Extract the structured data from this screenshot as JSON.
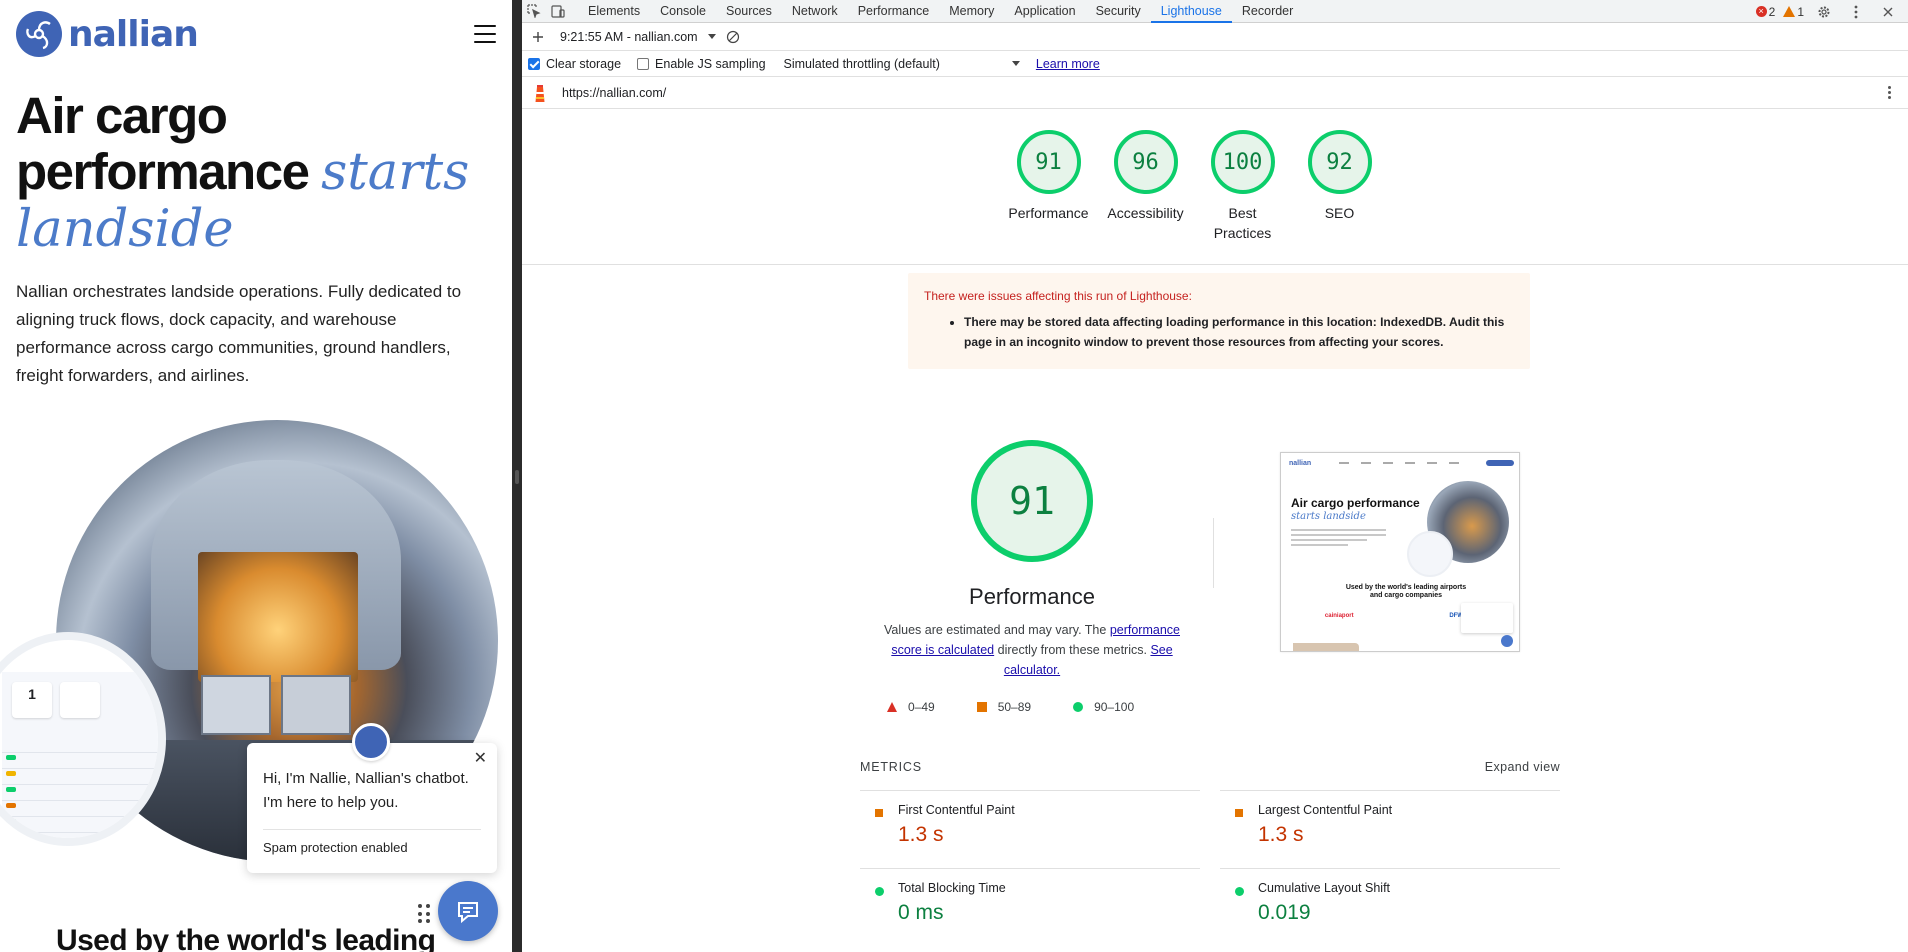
{
  "site": {
    "brand": "nallian",
    "hero": {
      "title_line1": "Air cargo",
      "title_line2": "performance",
      "title_script1": "starts",
      "title_script2": "landside",
      "description": "Nallian orchestrates landside operations. Fully dedicated to aligning truck flows, dock capacity, and warehouse performance across cargo communities, ground handlers, freight forwarders, and airlines."
    },
    "dashboard_card": {
      "count": "1"
    },
    "chat": {
      "message": "Hi, I'm Nallie, Nallian's chatbot. I'm here to help you.",
      "footer": "Spam protection enabled",
      "close_glyph": "✕"
    },
    "used_by_heading": "Used by the world's leading"
  },
  "devtools": {
    "tabs": [
      {
        "label": "Elements"
      },
      {
        "label": "Console"
      },
      {
        "label": "Sources"
      },
      {
        "label": "Network"
      },
      {
        "label": "Performance"
      },
      {
        "label": "Memory"
      },
      {
        "label": "Application"
      },
      {
        "label": "Security"
      },
      {
        "label": "Lighthouse"
      },
      {
        "label": "Recorder"
      }
    ],
    "active_tab": "Lighthouse",
    "error_count": "2",
    "warning_count": "1",
    "report_selector": "9:21:55 AM - nallian.com",
    "options": {
      "clear_storage": "Clear storage",
      "clear_storage_checked": true,
      "js_sampling": "Enable JS sampling",
      "js_sampling_checked": false,
      "throttling": "Simulated throttling (default)",
      "learn_more": "Learn more"
    },
    "url": "https://nallian.com/",
    "scores": [
      {
        "value": "91",
        "label": "Performance"
      },
      {
        "value": "96",
        "label": "Accessibility"
      },
      {
        "value": "100",
        "label": "Best Practices"
      },
      {
        "value": "92",
        "label": "SEO"
      }
    ],
    "warning": {
      "title": "There were issues affecting this run of Lighthouse:",
      "item": "There may be stored data affecting loading performance in this location: IndexedDB. Audit this page in an incognito window to prevent those resources from affecting your scores."
    },
    "performance": {
      "score": "91",
      "title": "Performance",
      "desc_prefix": "Values are estimated and may vary. The ",
      "desc_link1": "performance score is calculated",
      "desc_middle": " directly from these metrics. ",
      "desc_link2": "See calculator."
    },
    "legend": [
      {
        "range": "0–49",
        "color": "#d93025"
      },
      {
        "range": "50–89",
        "color": "#e37400"
      },
      {
        "range": "90–100",
        "color": "#0cce6b"
      }
    ],
    "screenshot": {
      "logo": "nallian",
      "headline1": "Air cargo performance",
      "headline2": "starts landside",
      "used_by": "Used by the world's leading airports and cargo companies",
      "logos": [
        "",
        "cainiaport",
        "",
        "",
        "DFW"
      ]
    },
    "metrics_title": "METRICS",
    "expand_view": "Expand view",
    "metrics": [
      {
        "name": "First Contentful Paint",
        "value": "1.3 s",
        "status": "average"
      },
      {
        "name": "Largest Contentful Paint",
        "value": "1.3 s",
        "status": "average"
      },
      {
        "name": "Total Blocking Time",
        "value": "0 ms",
        "status": "pass"
      },
      {
        "name": "Cumulative Layout Shift",
        "value": "0.019",
        "status": "pass"
      }
    ]
  }
}
